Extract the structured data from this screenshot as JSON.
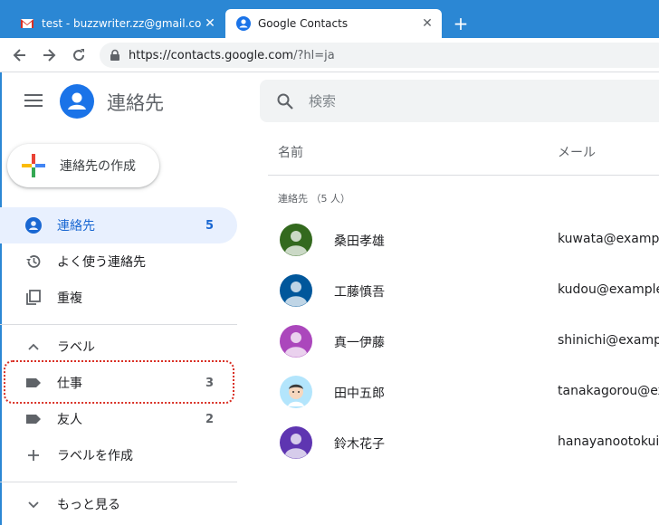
{
  "browser": {
    "tabs": [
      {
        "title": "test - buzzwriter.zz@gmail.com -",
        "close": "✕"
      },
      {
        "title": "Google Contacts",
        "close": "✕"
      }
    ],
    "new_tab": "+",
    "url": "https://contacts.google.com",
    "url_suffix": "/?hl=ja"
  },
  "app": {
    "title": "連絡先",
    "search_placeholder": "検索",
    "create_button": "連絡先の作成"
  },
  "sidebar": {
    "items": [
      {
        "label": "連絡先",
        "count": "5"
      },
      {
        "label": "よく使う連絡先"
      },
      {
        "label": "重複"
      },
      {
        "label": "ラベル"
      },
      {
        "label": "仕事",
        "count": "3"
      },
      {
        "label": "友人",
        "count": "2"
      },
      {
        "label": "ラベルを作成"
      },
      {
        "label": "もっと見る"
      }
    ]
  },
  "main": {
    "columns": {
      "name": "名前",
      "email": "メール"
    },
    "section_label": "連絡先 （5 人）",
    "contacts": [
      {
        "name": "桑田孝雄",
        "email": "kuwata@example",
        "avatar_color": "#33691e"
      },
      {
        "name": "工藤慎吾",
        "email": "kudou@example.c",
        "avatar_color": "#01579b"
      },
      {
        "name": "真一伊藤",
        "email": "shinichi@example",
        "avatar_color": "#ab47bc"
      },
      {
        "name": "田中五郎",
        "email": "tanakagorou@exa",
        "avatar_color": "#b3e5fc"
      },
      {
        "name": "鈴木花子",
        "email": "hanayanootokui@",
        "avatar_color": "#5e35b1"
      }
    ]
  },
  "colors": {
    "tabstrip": "#2b87d4",
    "accent": "#1a73e8",
    "active_bg": "#e8f0fe"
  }
}
